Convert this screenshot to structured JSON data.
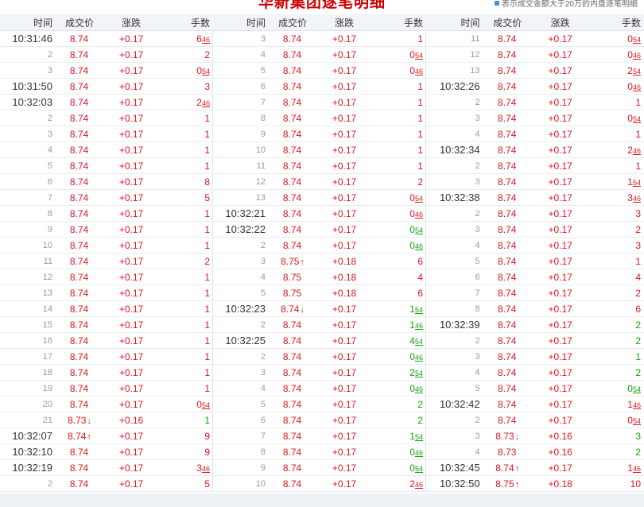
{
  "title": "华新集团逐笔明细",
  "legend": "表示成交金额大于20万的内盘逐笔明细",
  "headers": [
    "时间",
    "成交价",
    "涨跌",
    "手数"
  ],
  "colors": {
    "up": "#e0141e",
    "down": "#13a20b"
  },
  "panels": [
    {
      "rows": [
        [
          "10:31:46",
          "8.74",
          "",
          "+0.17",
          "6",
          "46",
          "r"
        ],
        [
          "2",
          "8.74",
          "",
          "+0.17",
          "2",
          "",
          "r"
        ],
        [
          "3",
          "8.74",
          "",
          "+0.17",
          "0",
          "54",
          "r"
        ],
        [
          "10:31:50",
          "8.74",
          "",
          "+0.17",
          "3",
          "",
          "r"
        ],
        [
          "10:32:03",
          "8.74",
          "",
          "+0.17",
          "2",
          "46",
          "r"
        ],
        [
          "2",
          "8.74",
          "",
          "+0.17",
          "1",
          "",
          "r"
        ],
        [
          "3",
          "8.74",
          "",
          "+0.17",
          "1",
          "",
          "r"
        ],
        [
          "4",
          "8.74",
          "",
          "+0.17",
          "1",
          "",
          "r"
        ],
        [
          "5",
          "8.74",
          "",
          "+0.17",
          "1",
          "",
          "r"
        ],
        [
          "6",
          "8.74",
          "",
          "+0.17",
          "8",
          "",
          "r"
        ],
        [
          "7",
          "8.74",
          "",
          "+0.17",
          "5",
          "",
          "r"
        ],
        [
          "8",
          "8.74",
          "",
          "+0.17",
          "1",
          "",
          "r"
        ],
        [
          "9",
          "8.74",
          "",
          "+0.17",
          "1",
          "",
          "r"
        ],
        [
          "10",
          "8.74",
          "",
          "+0.17",
          "1",
          "",
          "r"
        ],
        [
          "11",
          "8.74",
          "",
          "+0.17",
          "2",
          "",
          "r"
        ],
        [
          "12",
          "8.74",
          "",
          "+0.17",
          "1",
          "",
          "r"
        ],
        [
          "13",
          "8.74",
          "",
          "+0.17",
          "1",
          "",
          "r"
        ],
        [
          "14",
          "8.74",
          "",
          "+0.17",
          "1",
          "",
          "r"
        ],
        [
          "15",
          "8.74",
          "",
          "+0.17",
          "1",
          "",
          "r"
        ],
        [
          "16",
          "8.74",
          "",
          "+0.17",
          "1",
          "",
          "r"
        ],
        [
          "17",
          "8.74",
          "",
          "+0.17",
          "1",
          "",
          "r"
        ],
        [
          "18",
          "8.74",
          "",
          "+0.17",
          "1",
          "",
          "r"
        ],
        [
          "19",
          "8.74",
          "",
          "+0.17",
          "1",
          "",
          "r"
        ],
        [
          "20",
          "8.74",
          "",
          "+0.17",
          "0",
          "54",
          "r"
        ],
        [
          "21",
          "8.73",
          "↓",
          "+0.16",
          "1",
          "",
          "g"
        ],
        [
          "10:32:07",
          "8.74",
          "↑",
          "+0.17",
          "9",
          "",
          "r"
        ],
        [
          "10:32:10",
          "8.74",
          "",
          "+0.17",
          "9",
          "",
          "r"
        ],
        [
          "10:32:19",
          "8.74",
          "",
          "+0.17",
          "3",
          "46",
          "r"
        ],
        [
          "2",
          "8.74",
          "",
          "+0.17",
          "5",
          "",
          "r"
        ]
      ]
    },
    {
      "rows": [
        [
          "3",
          "8.74",
          "",
          "+0.17",
          "1",
          "",
          "r"
        ],
        [
          "4",
          "8.74",
          "",
          "+0.17",
          "0",
          "54",
          "r"
        ],
        [
          "5",
          "8.74",
          "",
          "+0.17",
          "0",
          "46",
          "r"
        ],
        [
          "6",
          "8.74",
          "",
          "+0.17",
          "1",
          "",
          "r"
        ],
        [
          "7",
          "8.74",
          "",
          "+0.17",
          "1",
          "",
          "r"
        ],
        [
          "8",
          "8.74",
          "",
          "+0.17",
          "1",
          "",
          "r"
        ],
        [
          "9",
          "8.74",
          "",
          "+0.17",
          "1",
          "",
          "r"
        ],
        [
          "10",
          "8.74",
          "",
          "+0.17",
          "1",
          "",
          "r"
        ],
        [
          "11",
          "8.74",
          "",
          "+0.17",
          "1",
          "",
          "r"
        ],
        [
          "12",
          "8.74",
          "",
          "+0.17",
          "2",
          "",
          "r"
        ],
        [
          "13",
          "8.74",
          "",
          "+0.17",
          "0",
          "54",
          "r"
        ],
        [
          "10:32:21",
          "8.74",
          "",
          "+0.17",
          "0",
          "46",
          "r"
        ],
        [
          "10:32:22",
          "8.74",
          "",
          "+0.17",
          "0",
          "54",
          "g"
        ],
        [
          "2",
          "8.74",
          "",
          "+0.17",
          "0",
          "46",
          "g"
        ],
        [
          "3",
          "8.75",
          "↑",
          "+0.18",
          "6",
          "",
          "r"
        ],
        [
          "4",
          "8.75",
          "",
          "+0.18",
          "4",
          "",
          "r"
        ],
        [
          "5",
          "8.75",
          "",
          "+0.18",
          "6",
          "",
          "r"
        ],
        [
          "10:32:23",
          "8.74",
          "↓",
          "+0.17",
          "1",
          "54",
          "g"
        ],
        [
          "2",
          "8.74",
          "",
          "+0.17",
          "1",
          "46",
          "g"
        ],
        [
          "10:32:25",
          "8.74",
          "",
          "+0.17",
          "4",
          "54",
          "g"
        ],
        [
          "2",
          "8.74",
          "",
          "+0.17",
          "0",
          "46",
          "g"
        ],
        [
          "3",
          "8.74",
          "",
          "+0.17",
          "2",
          "54",
          "g"
        ],
        [
          "4",
          "8.74",
          "",
          "+0.17",
          "0",
          "46",
          "g"
        ],
        [
          "5",
          "8.74",
          "",
          "+0.17",
          "2",
          "",
          "g"
        ],
        [
          "6",
          "8.74",
          "",
          "+0.17",
          "2",
          "",
          "g"
        ],
        [
          "7",
          "8.74",
          "",
          "+0.17",
          "1",
          "54",
          "g"
        ],
        [
          "8",
          "8.74",
          "",
          "+0.17",
          "0",
          "46",
          "g"
        ],
        [
          "9",
          "8.74",
          "",
          "+0.17",
          "0",
          "54",
          "g"
        ],
        [
          "10",
          "8.74",
          "",
          "+0.17",
          "2",
          "46",
          "r"
        ]
      ]
    },
    {
      "rows": [
        [
          "11",
          "8.74",
          "",
          "+0.17",
          "0",
          "54",
          "r"
        ],
        [
          "12",
          "8.74",
          "",
          "+0.17",
          "0",
          "46",
          "r"
        ],
        [
          "13",
          "8.74",
          "",
          "+0.17",
          "2",
          "54",
          "r"
        ],
        [
          "10:32:26",
          "8.74",
          "",
          "+0.17",
          "0",
          "46",
          "r"
        ],
        [
          "2",
          "8.74",
          "",
          "+0.17",
          "1",
          "",
          "r"
        ],
        [
          "3",
          "8.74",
          "",
          "+0.17",
          "0",
          "54",
          "r"
        ],
        [
          "4",
          "8.74",
          "",
          "+0.17",
          "1",
          "",
          "r"
        ],
        [
          "10:32:34",
          "8.74",
          "",
          "+0.17",
          "2",
          "46",
          "r"
        ],
        [
          "2",
          "8.74",
          "",
          "+0.17",
          "1",
          "",
          "r"
        ],
        [
          "3",
          "8.74",
          "",
          "+0.17",
          "1",
          "54",
          "r"
        ],
        [
          "10:32:38",
          "8.74",
          "",
          "+0.17",
          "3",
          "46",
          "r"
        ],
        [
          "2",
          "8.74",
          "",
          "+0.17",
          "3",
          "",
          "r"
        ],
        [
          "3",
          "8.74",
          "",
          "+0.17",
          "2",
          "",
          "r"
        ],
        [
          "4",
          "8.74",
          "",
          "+0.17",
          "3",
          "",
          "r"
        ],
        [
          "5",
          "8.74",
          "",
          "+0.17",
          "1",
          "",
          "r"
        ],
        [
          "6",
          "8.74",
          "",
          "+0.17",
          "4",
          "",
          "r"
        ],
        [
          "7",
          "8.74",
          "",
          "+0.17",
          "2",
          "",
          "r"
        ],
        [
          "8",
          "8.74",
          "",
          "+0.17",
          "6",
          "",
          "r"
        ],
        [
          "10:32:39",
          "8.74",
          "",
          "+0.17",
          "2",
          "",
          "g"
        ],
        [
          "2",
          "8.74",
          "",
          "+0.17",
          "2",
          "",
          "g"
        ],
        [
          "3",
          "8.74",
          "",
          "+0.17",
          "1",
          "",
          "g"
        ],
        [
          "4",
          "8.74",
          "",
          "+0.17",
          "2",
          "",
          "g"
        ],
        [
          "5",
          "8.74",
          "",
          "+0.17",
          "0",
          "54",
          "g"
        ],
        [
          "10:32:42",
          "8.74",
          "",
          "+0.17",
          "1",
          "46",
          "r"
        ],
        [
          "2",
          "8.74",
          "",
          "+0.17",
          "0",
          "54",
          "r"
        ],
        [
          "3",
          "8.73",
          "↓",
          "+0.16",
          "3",
          "",
          "g"
        ],
        [
          "4",
          "8.73",
          "",
          "+0.16",
          "2",
          "",
          "g"
        ],
        [
          "10:32:45",
          "8.74",
          "↑",
          "+0.17",
          "1",
          "46",
          "r"
        ],
        [
          "10:32:50",
          "8.75",
          "↑",
          "+0.18",
          "10",
          "",
          "r"
        ]
      ]
    }
  ]
}
